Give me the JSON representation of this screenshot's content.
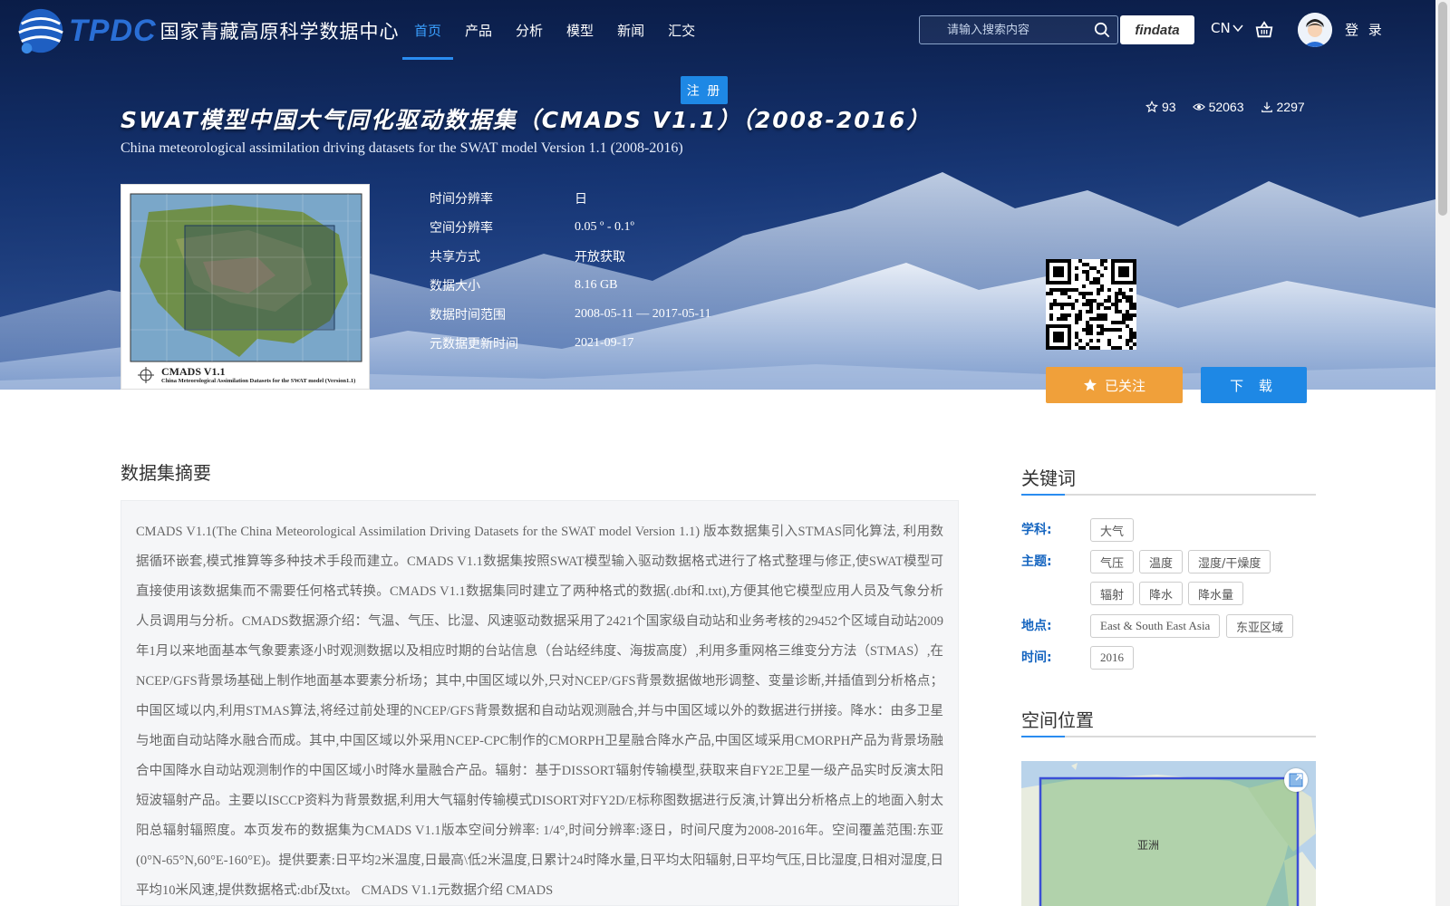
{
  "header": {
    "logo_text": "TPDC",
    "logo_subtitle": "国家青藏高原科学数据中心",
    "nav": [
      "首页",
      "产品",
      "分析",
      "模型",
      "新闻",
      "汇交"
    ],
    "search_placeholder": "请输入搜索内容",
    "findata_label": "findata",
    "lang_label": "CN",
    "login_label": "登 录",
    "register_label": "注 册"
  },
  "dataset": {
    "title_cn": "SWAT模型中国大气同化驱动数据集（CMADS V1.1）（2008-2016）",
    "title_en": "China meteorological assimilation driving datasets for the SWAT model Version 1.1 (2008-2016)",
    "stats": {
      "stars": "93",
      "views": "52063",
      "downloads": "2297"
    },
    "thumbnail": {
      "caption": "CMADS V1.1",
      "subcaption": "China Meteorological Assimilation Datasets for the SWAT model (Version1.1)"
    },
    "meta": [
      {
        "label": "时间分辨率",
        "value": "日"
      },
      {
        "label": "空间分辨率",
        "value": "0.05 º - 0.1º"
      },
      {
        "label": "共享方式",
        "value": "开放获取"
      },
      {
        "label": "数据大小",
        "value": "8.16 GB"
      },
      {
        "label": "数据时间范围",
        "value": "2008-05-11 — 2017-05-11"
      },
      {
        "label": "元数据更新时间",
        "value": "2021-09-17"
      }
    ],
    "follow_label": "已关注",
    "download_label": "下 载"
  },
  "abstract": {
    "title": "数据集摘要",
    "text": "CMADS V1.1(The China Meteorological Assimilation Driving Datasets for the SWAT model Version 1.1) 版本数据集引入STMAS同化算法, 利用数据循环嵌套,模式推算等多种技术手段而建立。CMADS V1.1数据集按照SWAT模型输入驱动数据格式进行了格式整理与修正,使SWAT模型可直接使用该数据集而不需要任何格式转换。CMADS V1.1数据集同时建立了两种格式的数据(.dbf和.txt),方便其他它模型应用人员及气象分析人员调用与分析。CMADS数据源介绍：气温、气压、比湿、风速驱动数据采用了2421个国家级自动站和业务考核的29452个区域自动站2009年1月以来地面基本气象要素逐小时观测数据以及相应时期的台站信息（台站经纬度、海拔高度）,利用多重网格三维变分方法（STMAS）,在NCEP/GFS背景场基础上制作地面基本要素分析场；其中,中国区域以外,只对NCEP/GFS背景数据做地形调整、变量诊断,并插值到分析格点；中国区域以内,利用STMAS算法,将经过前处理的NCEP/GFS背景数据和自动站观测融合,并与中国区域以外的数据进行拼接。降水：由多卫星与地面自动站降水融合而成。其中,中国区域以外采用NCEP-CPC制作的CMORPH卫星融合降水产品,中国区域采用CMORPH产品为背景场融合中国降水自动站观测制作的中国区域小时降水量融合产品。辐射：基于DISSORT辐射传输模型,获取来自FY2E卫星一级产品实时反演太阳短波辐射产品。主要以ISCCP资料为背景数据,利用大气辐射传输模式DISORT对FY2D/E标称图数据进行反演,计算出分析格点上的地面入射太阳总辐射辐照度。本页发布的数据集为CMADS V1.1版本空间分辨率: 1/4°,时间分辨率:逐日，时间尺度为2008-2016年。空间覆盖范围:东亚(0°N-65°N,60°E-160°E)。提供要素:日平均2米温度,日最高\\低2米温度,日累计24时降水量,日平均太阳辐射,日平均气压,日比湿度,日相对湿度,日平均10米风速,提供数据格式:dbf及txt。 CMADS V1.1元数据介绍 CMADS"
  },
  "keywords": {
    "title": "关键词",
    "groups": [
      {
        "label": "学科:",
        "tags": [
          "大气"
        ]
      },
      {
        "label": "主题:",
        "tags": [
          "气压",
          "温度",
          "湿度/干燥度",
          "辐射",
          "降水",
          "降水量"
        ]
      },
      {
        "label": "地点:",
        "tags": [
          "East & South East Asia",
          "东亚区域"
        ]
      },
      {
        "label": "时间:",
        "tags": [
          "2016"
        ]
      }
    ]
  },
  "spatial": {
    "title": "空间位置",
    "map_label": "亚洲"
  },
  "colors": {
    "accent": "#1e88e5",
    "follow": "#f0a03a",
    "keyword_label": "#1565c0"
  }
}
